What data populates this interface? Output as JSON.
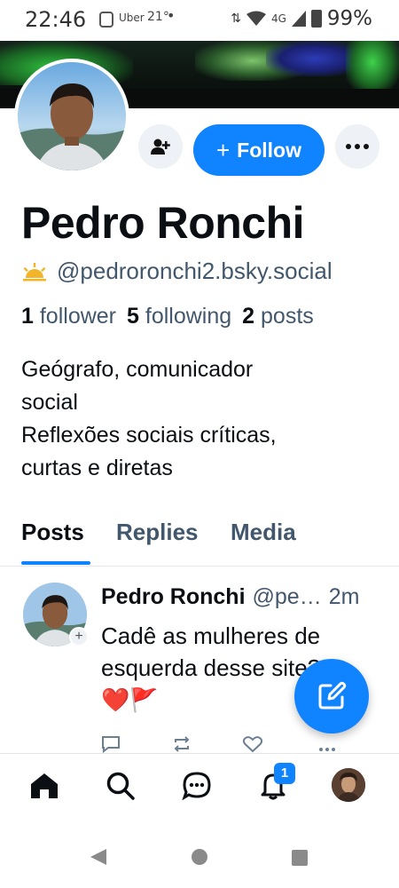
{
  "status_bar": {
    "time": "22:46",
    "notif_app": "Uber",
    "temperature": "21°",
    "network": "4G",
    "battery": "99%"
  },
  "profile": {
    "display_name": "Pedro Ronchi",
    "handle": "@pedroronchi2.bsky.social",
    "follow_label": "Follow",
    "follow_plus": "+",
    "stats": {
      "followers_count": "1",
      "followers_label": "follower",
      "following_count": "5",
      "following_label": "following",
      "posts_count": "2",
      "posts_label": "posts"
    },
    "bio": {
      "line1": "Geógrafo, comunicador",
      "line2": "social",
      "line3": "Reflexões sociais críticas,",
      "line4": "curtas e diretas"
    }
  },
  "tabs": [
    {
      "label": "Posts",
      "active": true
    },
    {
      "label": "Replies",
      "active": false
    },
    {
      "label": "Media",
      "active": false
    }
  ],
  "post": {
    "author": "Pedro Ronchi",
    "handle": "@pe…",
    "time": "2m",
    "text_line1": "Cadê as mulheres de",
    "text_line2": "esquerda desse site?",
    "emoji": "❤️🚩"
  },
  "bottom_nav": {
    "notification_count": "1"
  },
  "icons": {
    "handle_badge": "sun-icon",
    "add_user": "person-plus-icon",
    "more": "ellipsis-icon",
    "compose": "pencil-square-icon",
    "nav": [
      "home-icon",
      "search-icon",
      "chat-icon",
      "bell-icon",
      "profile-avatar"
    ]
  },
  "colors": {
    "accent": "#1083fe",
    "text_primary": "#0b0f14",
    "text_secondary": "#42576c",
    "button_bg": "#eef1f5"
  }
}
